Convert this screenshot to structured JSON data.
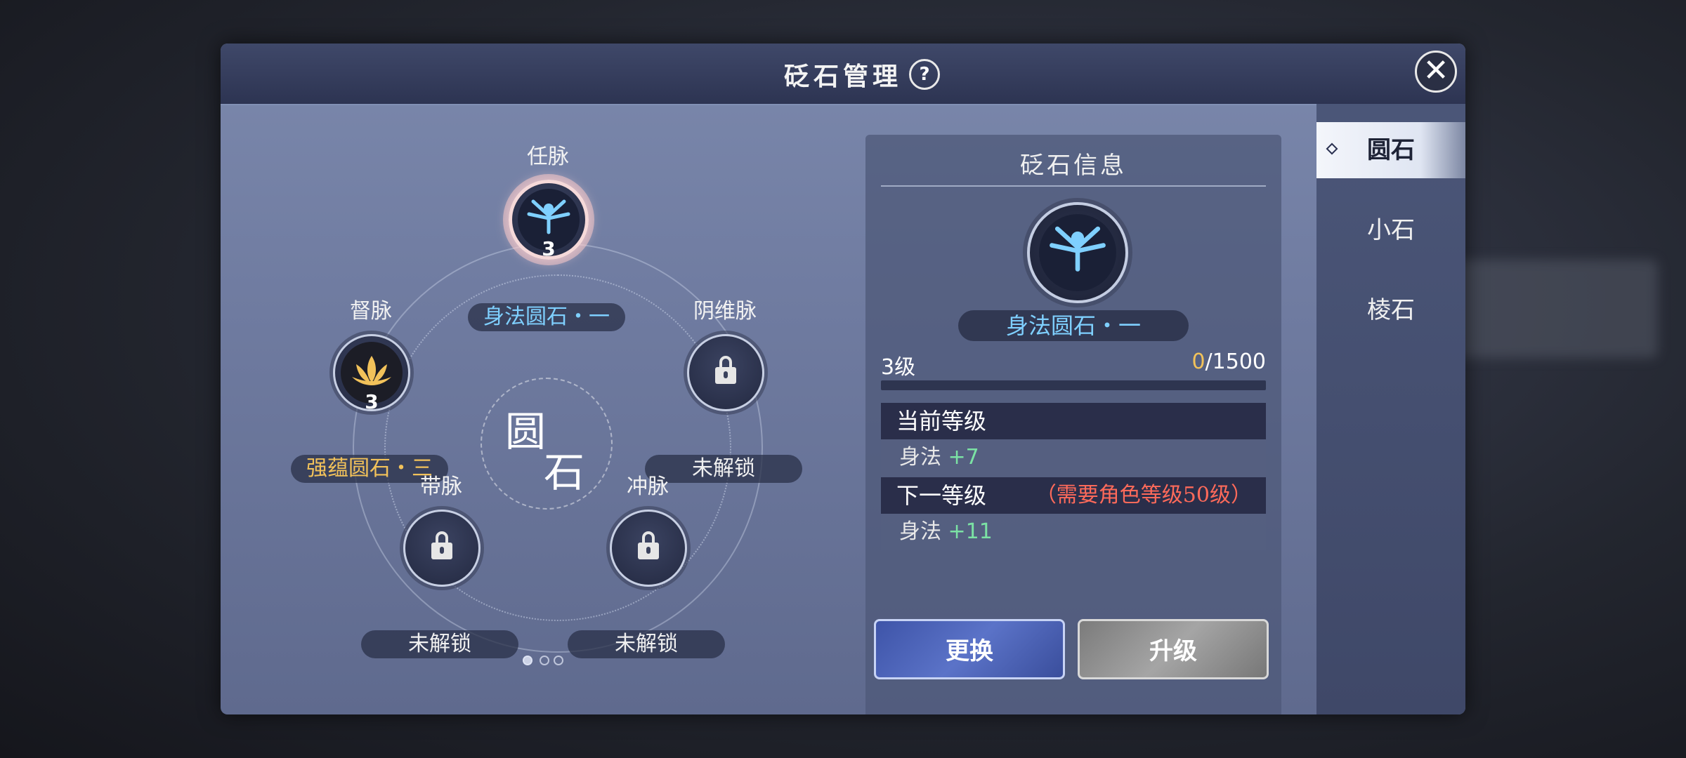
{
  "window": {
    "title": "砭石管理",
    "help_icon": "?",
    "close_icon": "✕"
  },
  "center": {
    "char1": "圆",
    "char2": "石"
  },
  "nodes": [
    {
      "meridian": "任脉",
      "stone_name": "身法圆石・一",
      "level": "3",
      "state": "equipped",
      "selected": true,
      "icon": "figure-icon",
      "color": "#7fd0ff"
    },
    {
      "meridian": "督脉",
      "stone_name": "强蕴圆石・三",
      "level": "3",
      "state": "equipped",
      "selected": false,
      "icon": "lotus-icon",
      "color": "#f2c25a"
    },
    {
      "meridian": "阴维脉",
      "stone_name": "未解锁",
      "state": "locked",
      "icon": "lock-icon"
    },
    {
      "meridian": "带脉",
      "stone_name": "未解锁",
      "state": "locked",
      "icon": "lock-icon"
    },
    {
      "meridian": "冲脉",
      "stone_name": "未解锁",
      "state": "locked",
      "icon": "lock-icon"
    }
  ],
  "info": {
    "title": "砭石信息",
    "stone_name": "身法圆石・一",
    "level_label": "3级",
    "exp_current": "0",
    "exp_total": "/1500",
    "exp_fraction": 0,
    "current_level_header": "当前等级",
    "current_stat_name": "身法",
    "current_stat_value": "+7",
    "next_level_header": "下一等级",
    "next_level_requirement": "（需要角色等级50级）",
    "next_stat_name": "身法",
    "next_stat_value": "+11",
    "change_button": "更换",
    "upgrade_button": "升级"
  },
  "tabs": [
    {
      "label": "圆石",
      "active": true
    },
    {
      "label": "小石",
      "active": false
    },
    {
      "label": "棱石",
      "active": false
    }
  ]
}
